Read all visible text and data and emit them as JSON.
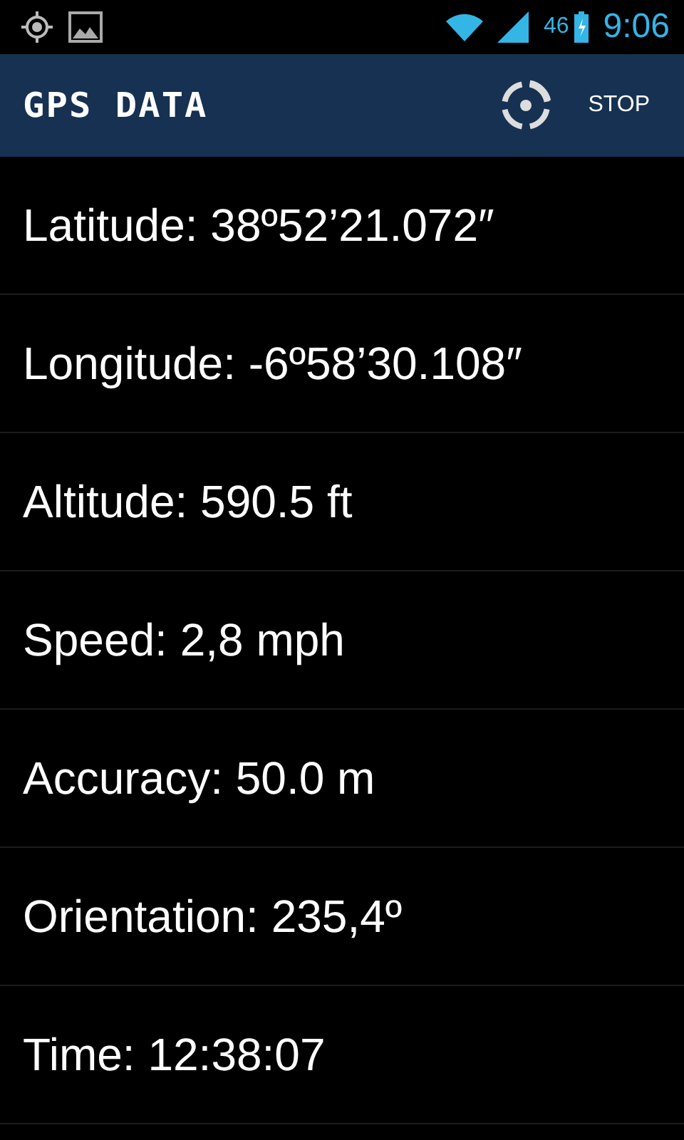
{
  "status_bar": {
    "network": "46",
    "time": "9:06"
  },
  "app_bar": {
    "title": "GPS DATA",
    "action": "STOP"
  },
  "rows": [
    {
      "text": "Latitude: 38º52’21.072″"
    },
    {
      "text": "Longitude: -6º58’30.108″"
    },
    {
      "text": "Altitude: 590.5 ft"
    },
    {
      "text": "Speed: 2,8 mph"
    },
    {
      "text": "Accuracy: 50.0 m"
    },
    {
      "text": "Orientation: 235,4º"
    },
    {
      "text": "Time: 12:38:07"
    }
  ]
}
